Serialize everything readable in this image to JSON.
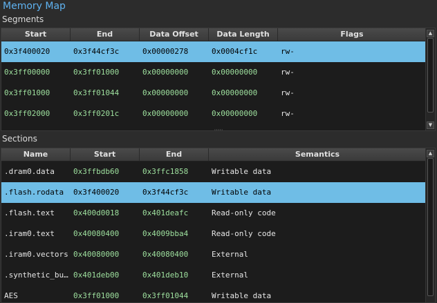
{
  "title": "Memory Map",
  "segments": {
    "label": "Segments",
    "columns": [
      "Start",
      "End",
      "Data Offset",
      "Data Length",
      "Flags"
    ],
    "rows": [
      {
        "start": "0x3f400020",
        "end": "0x3f44cf3c",
        "offset": "0x00000278",
        "length": "0x0004cf1c",
        "flags": "rw-",
        "selected": true
      },
      {
        "start": "0x3ff00000",
        "end": "0x3ff01000",
        "offset": "0x00000000",
        "length": "0x00000000",
        "flags": "rw-",
        "selected": false
      },
      {
        "start": "0x3ff01000",
        "end": "0x3ff01044",
        "offset": "0x00000000",
        "length": "0x00000000",
        "flags": "rw-",
        "selected": false
      },
      {
        "start": "0x3ff02000",
        "end": "0x3ff0201c",
        "offset": "0x00000000",
        "length": "0x00000000",
        "flags": "rw-",
        "selected": false
      }
    ]
  },
  "sections": {
    "label": "Sections",
    "columns": [
      "Name",
      "Start",
      "End",
      "Semantics"
    ],
    "rows": [
      {
        "name": ".dram0.data",
        "start": "0x3ffbdb60",
        "end": "0x3ffc1858",
        "semantics": "Writable data",
        "selected": false
      },
      {
        "name": ".flash.rodata",
        "start": "0x3f400020",
        "end": "0x3f44cf3c",
        "semantics": "Writable data",
        "selected": true
      },
      {
        "name": ".flash.text",
        "start": "0x400d0018",
        "end": "0x401deafc",
        "semantics": "Read-only code",
        "selected": false
      },
      {
        "name": ".iram0.text",
        "start": "0x40080400",
        "end": "0x4009bba4",
        "semantics": "Read-only code",
        "selected": false
      },
      {
        "name": ".iram0.vectors",
        "start": "0x40080000",
        "end": "0x40080400",
        "semantics": "External",
        "selected": false
      },
      {
        "name": ".synthetic_bu…",
        "start": "0x401deb00",
        "end": "0x401deb10",
        "semantics": "External",
        "selected": false
      },
      {
        "name": "AES",
        "start": "0x3ff01000",
        "end": "0x3ff01044",
        "semantics": "Writable data",
        "selected": false
      }
    ]
  },
  "icons": {
    "scroll_up": "arrow-up-icon",
    "scroll_down": "arrow-down-icon",
    "splitter": "splitter-grip-icon"
  },
  "colors": {
    "accent": "#5fb2f0",
    "selection": "#6fbde6",
    "value": "#9ee09e"
  }
}
